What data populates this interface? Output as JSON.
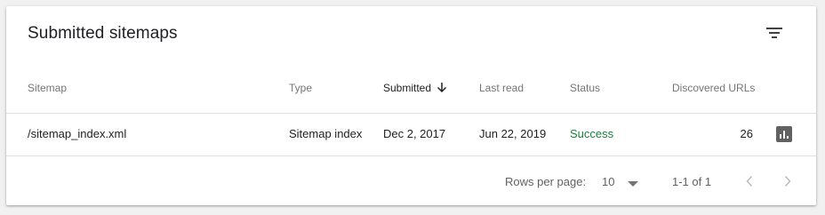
{
  "card": {
    "title": "Submitted sitemaps",
    "filter_icon": "filter-list-icon"
  },
  "table": {
    "columns": {
      "sitemap": "Sitemap",
      "type": "Type",
      "submitted": "Submitted",
      "last_read": "Last read",
      "status": "Status",
      "discovered_urls": "Discovered URLs"
    },
    "sorted_column": "submitted",
    "sort_direction": "descending",
    "rows": [
      {
        "sitemap": "/sitemap_index.xml",
        "type": "Sitemap index",
        "submitted": "Dec 2, 2017",
        "last_read": "Jun 22, 2019",
        "status": "Success",
        "discovered_urls": "26",
        "action_icon": "bar-chart-icon"
      }
    ]
  },
  "pagination": {
    "rows_per_page_label": "Rows per page:",
    "rows_per_page_value": "10",
    "range_text": "1-1 of 1"
  },
  "colors": {
    "success": "#188038",
    "header_text": "#757575",
    "divider": "#e0e0e0"
  }
}
